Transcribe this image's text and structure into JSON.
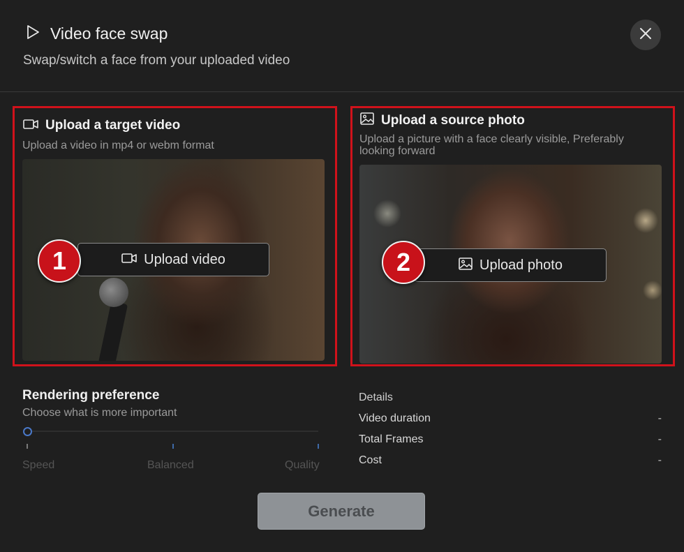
{
  "header": {
    "title": "Video face swap",
    "subtitle": "Swap/switch a face from your uploaded video",
    "icons": {
      "title": "play-icon",
      "close": "close-icon"
    }
  },
  "target_video": {
    "title": "Upload a target video",
    "description": "Upload a video in mp4 or webm format",
    "button_label": "Upload video",
    "step": "1",
    "icon": "video-camera-icon"
  },
  "source_photo": {
    "title": "Upload a source photo",
    "description_line1": "Upload a picture with a face clearly visible, Preferably",
    "description_line2": "looking forward",
    "button_label": "Upload photo",
    "step": "2",
    "icon": "image-icon"
  },
  "rendering": {
    "title": "Rendering preference",
    "description": "Choose what is more important",
    "options": [
      "Speed",
      "Balanced",
      "Quality"
    ],
    "selected": "Speed"
  },
  "details": {
    "title": "Details",
    "rows": [
      {
        "label": "Video duration",
        "value": "-"
      },
      {
        "label": "Total Frames",
        "value": "-"
      },
      {
        "label": "Cost",
        "value": "-"
      }
    ]
  },
  "actions": {
    "generate_label": "Generate"
  },
  "colors": {
    "highlight": "#d0121b",
    "badge": "#c8121a",
    "slider_accent": "#4a78c8",
    "disabled_button": "#8e9296"
  }
}
